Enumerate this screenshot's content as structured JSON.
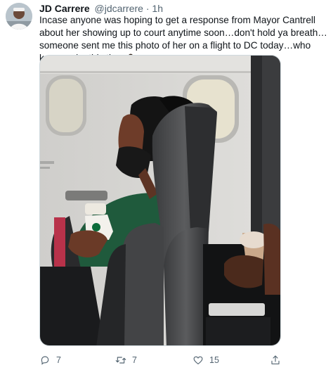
{
  "tweet": {
    "display_name": "JD Carrere",
    "handle": "@jdcarrere",
    "separator": "·",
    "time": "1h",
    "text": "Incase anyone was hoping to get a response from Mayor Cantrell about her showing up to court anytime soon…don't hold ya breath…someone sent me this photo of her on a flight to DC today…who knows why this time",
    "emoji": "person-shrugging-emoji"
  },
  "actions": {
    "reply_count": "7",
    "retweet_count": "7",
    "like_count": "15"
  },
  "icons": {
    "reply": "reply-icon",
    "retweet": "retweet-icon",
    "like": "heart-icon",
    "share": "share-icon"
  },
  "colors": {
    "text": "#0f1419",
    "secondary": "#536471",
    "border": "#cfd9de"
  }
}
